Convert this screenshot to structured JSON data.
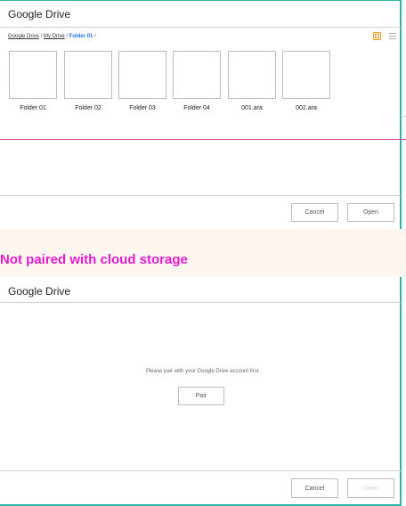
{
  "file_picker": {
    "title": "Google Drive",
    "breadcrumb": {
      "items": [
        "Google Drive",
        "My Drive"
      ],
      "current": "Folder 01",
      "separator": "/"
    },
    "view_mode": "grid",
    "tiles": [
      {
        "label": "Folder 01"
      },
      {
        "label": "Folder 02"
      },
      {
        "label": "Folder 03"
      },
      {
        "label": "Folder 04"
      },
      {
        "label": "001.ara"
      },
      {
        "label": "002.ara"
      }
    ],
    "cancel_label": "Cancel",
    "open_label": "Open"
  },
  "banner": {
    "text": "Not paired with cloud storage",
    "color": "#e21ad2"
  },
  "unpaired": {
    "title": "Google Drive",
    "message": "Please pair with your Google Drive account first.",
    "pair_label": "Pair",
    "cancel_label": "Cancel",
    "open_label": "Open",
    "open_disabled": true
  },
  "colors": {
    "frame": "#2bb5a6",
    "breadcrumb_current": "#1a73e8",
    "grid_toggle": "#f0a020",
    "divider_accent": "#e0409a"
  }
}
